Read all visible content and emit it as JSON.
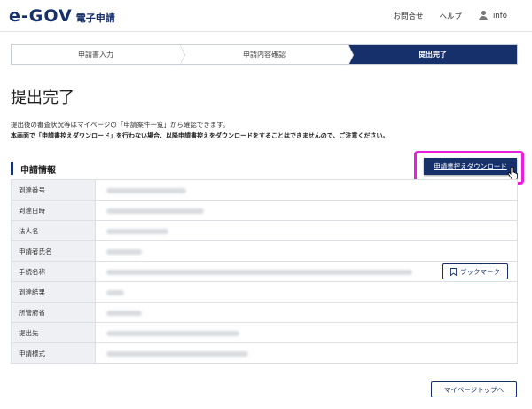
{
  "header": {
    "logo_mark": "e-GOV",
    "logo_sub": "電子申請",
    "nav_contact": "お問合せ",
    "nav_help": "ヘルプ",
    "nav_user": "info"
  },
  "steps": [
    {
      "label": "申請書入力",
      "state": "done"
    },
    {
      "label": "申請内容確認",
      "state": "done"
    },
    {
      "label": "提出完了",
      "state": "active"
    }
  ],
  "page": {
    "title": "提出完了",
    "info_text": "提出後の審査状況等はマイページの「申請案件一覧」から確認できます。",
    "warn_text": "本画面で「申請書控えダウンロード」を行わない場合、以降申請書控えをダウンロードをすることはできませんので、ご注意ください。"
  },
  "section": {
    "title": "申請情報",
    "download_label": "申請書控えダウンロード"
  },
  "table": {
    "rows": [
      {
        "label": "到達番号"
      },
      {
        "label": "到達日時"
      },
      {
        "label": "法人名"
      },
      {
        "label": "申請者氏名"
      },
      {
        "label": "手続名称"
      },
      {
        "label": "到達結果"
      },
      {
        "label": "所管府省"
      },
      {
        "label": "提出先"
      },
      {
        "label": "申請様式"
      }
    ],
    "bookmark_label": "ブックマーク"
  },
  "footer": {
    "mypage_label": "マイページトップへ"
  },
  "colors": {
    "brand": "#16306b",
    "highlight": "#ec1ce0"
  }
}
